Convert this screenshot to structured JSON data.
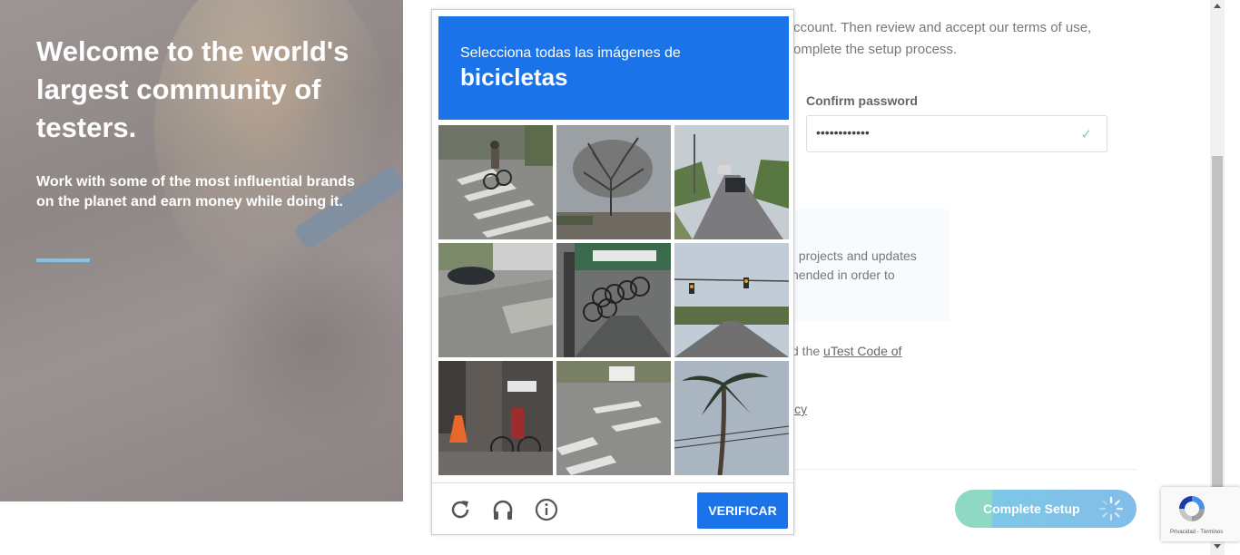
{
  "hero": {
    "title": "Welcome to the world's largest community of testers.",
    "subtitle": "Work with some of the most influential brands on the planet and earn money while doing it."
  },
  "form": {
    "intro_line1": "ccount. Then review and accept our terms of use,",
    "intro_line2": "omplete the setup process.",
    "confirm_label": "Confirm password",
    "confirm_value": "••••••••••••",
    "info_line1": "; projects and updates",
    "info_line2": "nended in order to",
    "code_prefix": "d the ",
    "code_link": "uTest Code of",
    "policy_fragment": "icy",
    "submit_label": "Complete Setup"
  },
  "captcha": {
    "prompt": "Selecciona todas las imágenes de",
    "target": "bicicletas",
    "verify_label": "VERIFICAR",
    "tiles": [
      "crosswalk-cyclist",
      "bare-tree",
      "street-car",
      "car-road",
      "parked-bicycles",
      "traffic-lights",
      "cyclist-storefront",
      "crosswalk-van",
      "palm-tree"
    ]
  },
  "recaptcha_badge": {
    "text": "Privacidad - Términos"
  },
  "colors": {
    "captcha_blue": "#1a73e8",
    "accent": "#7fc6e6",
    "button_green": "#8fd9c4"
  }
}
